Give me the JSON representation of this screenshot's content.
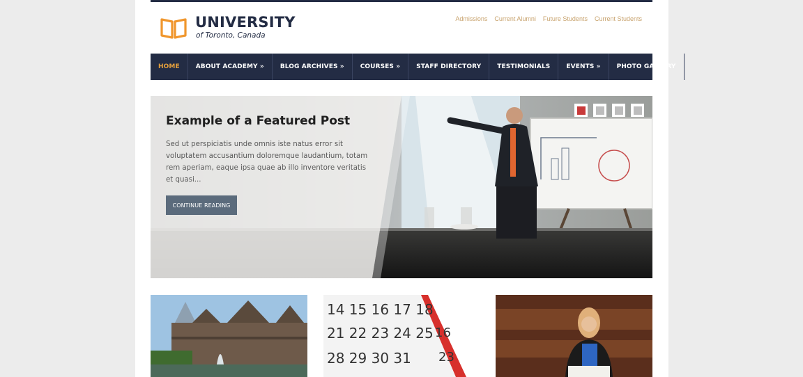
{
  "site": {
    "title": "UNIVERSITY",
    "subtitle": "of Toronto, Canada"
  },
  "top_links": [
    "Admissions",
    "Current Alumni",
    "Future Students",
    "Current Students"
  ],
  "nav": {
    "items": [
      {
        "label": "HOME"
      },
      {
        "label": "ABOUT ACADEMY »"
      },
      {
        "label": "BLOG ARCHIVES »"
      },
      {
        "label": "COURSES »"
      },
      {
        "label": "STAFF DIRECTORY"
      },
      {
        "label": "TESTIMONIALS"
      },
      {
        "label": "EVENTS »"
      },
      {
        "label": "PHOTO GALLERY"
      }
    ],
    "active_index": 0
  },
  "featured": {
    "title": "Example of a Featured Post",
    "excerpt": "Sed ut perspiciatis unde omnis iste natus error sit voluptatem accusantium doloremque laudantium, totam rem aperiam, eaque ipsa quae ab illo inventore veritatis et quasi...",
    "button_label": "CONTINUE READING",
    "slide_count": 4,
    "active_slide": 0
  },
  "colors": {
    "brand_navy": "#232c44",
    "accent_orange": "#e6a03c",
    "link_gold": "#c8a36e",
    "active_dot": "#c83a3a"
  },
  "icons": {
    "logo": "open-book-icon"
  }
}
